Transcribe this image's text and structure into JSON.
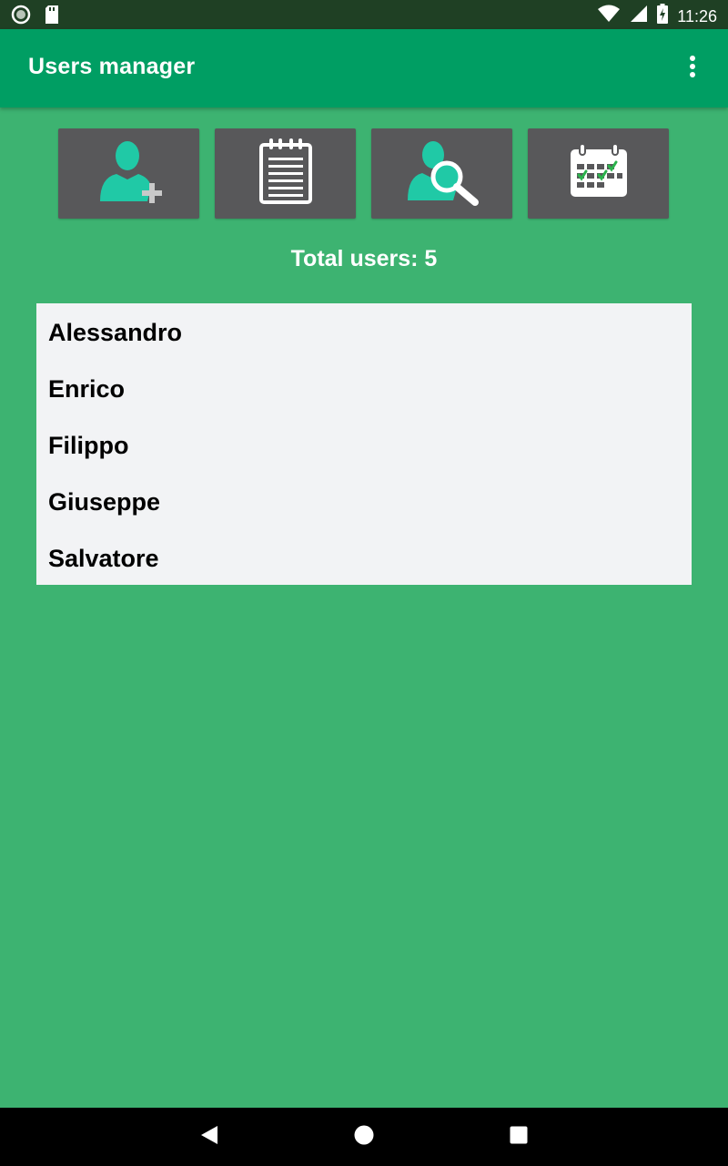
{
  "status_bar": {
    "time": "11:26",
    "icons": [
      "circle-notification-icon",
      "sd-card-icon",
      "wifi-icon",
      "signal-icon",
      "battery-icon"
    ]
  },
  "app_bar": {
    "title": "Users manager",
    "overflow_icon": "more-vert-icon",
    "background": "#009e63"
  },
  "toolbar": {
    "buttons": [
      {
        "icon": "add-user-icon"
      },
      {
        "icon": "notepad-icon"
      },
      {
        "icon": "search-user-icon"
      },
      {
        "icon": "calendar-icon"
      }
    ],
    "button_color": "#58585a",
    "icon_accent": "#20c9a6"
  },
  "summary": {
    "total_users": "Total users: 5"
  },
  "users": [
    "Alessandro",
    "Enrico",
    "Filippo",
    "Giuseppe",
    "Salvatore"
  ],
  "nav_bar": {
    "icons": [
      "back-icon",
      "home-icon",
      "recents-icon"
    ]
  },
  "colors": {
    "page_background": "#3db371",
    "status_bar": "#1f4024",
    "list_background": "#f2f3f5"
  }
}
